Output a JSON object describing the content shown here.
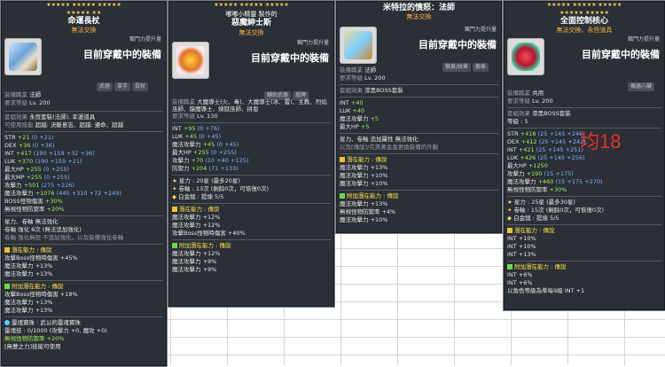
{
  "annotation": "均18",
  "card1": {
    "stars_row1": "★★★★★ ★★★★★ ★★★★★",
    "stars_row2": "★★★★★ ★★",
    "title": "命運長杖",
    "subtitle": "無法交換",
    "upgrade_label": "職門力提升量",
    "wearing": "目前穿戴中的裝備",
    "req_job_label": "裝備職業",
    "req_job": "法師",
    "req_level_label": "要求等級",
    "req_level": "Lv. 200",
    "job_tags": [
      "武器",
      "單手",
      "長杖"
    ],
    "set_label": "套組效果",
    "set_value": "永恆套裝(法師), 幸運道具",
    "trade_label": "可使用技能",
    "trade_value": "超越: 決斷意志、超越: 遵命、超越",
    "lines": [
      {
        "k": "STR",
        "v": "+21",
        "e": "(0 +21)"
      },
      {
        "k": "DEX",
        "v": "+36",
        "e": "(0 +36)"
      },
      {
        "k": "INT",
        "v": "+417",
        "e": "(190 +159 +32 +36)"
      },
      {
        "k": "LUK",
        "v": "+370",
        "e": "(190 +159 +21)"
      },
      {
        "k": "最大HP",
        "v": "+255",
        "e": "(0 +255)"
      },
      {
        "k": "最大MP",
        "v": "+255",
        "e": "(0 +255)"
      },
      {
        "k": "攻擊力",
        "v": "+501",
        "e": "(275 +226)"
      },
      {
        "k": "魔法攻擊力",
        "v": "+1076",
        "e": "(445 +310 +72 +249)"
      },
      {
        "k": "BOSS怪物傷害",
        "v": "+30%",
        "e": ""
      },
      {
        "k": "無視怪物防禦率",
        "v": "+20%",
        "e": ""
      }
    ],
    "star_label": "星力、卷軸 無法強化",
    "scroll_line": "卷軸 強化 8次 (無法追加強化)",
    "extra_note": "卷軸 強化無限 不追加強化。以及裝備強化卷軸",
    "pot_title": "潛在能力 : 傳說",
    "pot_lines": [
      "攻擊Boss怪物時傷害 +45%",
      "魔法攻擊力 +13%",
      "魔法攻擊力 +13%"
    ],
    "add_title": "附加潛在能力 : 傳說",
    "add_lines": [
      "攻擊Boss怪物時傷害 +18%",
      "魔法攻擊力 +13%",
      "魔法攻擊力 +13%"
    ],
    "soul_label": "靈魂寶珠 : 武公的靈魂寶珠",
    "soul_line": "靈魂技 : 0/1000 (攻擊力 +0, 魔攻 +0)",
    "soul_extra": "無視怪物防禦率 +20%",
    "footer": "[無雙之力]技能可使用"
  },
  "card2": {
    "stars_row1": "★★★★★ ★★★★★ ★★★★★",
    "maker": "嘟嘟小精靈 製作的",
    "title": "惡魔紳士斯",
    "subtitle": "無法交換",
    "upgrade_label": "職門力提升量",
    "wearing": "目前穿戴中的裝備",
    "req_job_label": "裝備職業",
    "req_job": "大魔導士(火、毒)、大魔導士(冰、雷)、主教、烈焰巫師、龍魔導士、煉獄巫師、拼恩",
    "req_level_label": "要求等級",
    "req_level": "Lv. 130",
    "job_tags": [
      "輔助武器",
      "盾牌"
    ],
    "lines": [
      {
        "k": "INT",
        "v": "+95",
        "e": "(0 +76)"
      },
      {
        "k": "LUK",
        "v": "+45",
        "e": "(0 +45)"
      },
      {
        "k": "魔法攻擊力",
        "v": "+45",
        "e": "(0 +45)"
      },
      {
        "k": "最大HP",
        "v": "+255",
        "e": "(0 +255)"
      },
      {
        "k": "攻擊力",
        "v": "+70",
        "e": "(10 +40 +125)"
      },
      {
        "k": "防禦力",
        "v": "+204",
        "e": "(71 +133)"
      }
    ],
    "star_label": "星力 : 20星 (最多20星)",
    "scroll_line": "卷軸 : 13次 (剩餘0次，可恢復0次)",
    "gold": "白金鎚 : 提煉 5/5",
    "pot_title": "潛在能力 : 傳說",
    "pot_lines": [
      "魔法攻擊力 +12%",
      "魔法攻擊力 +12%",
      "攻擊Boss怪物時傷害 +40%"
    ],
    "add_title": "附加潛在能力 : 傳說",
    "add_lines": [
      "魔法攻擊力 +12%",
      "魔法攻擊力 +9%",
      "魔法攻擊力 +9%"
    ]
  },
  "card3": {
    "header": "米特拉的憤怒：法師",
    "subtitle": "無法交換",
    "upgrade_label": "職門力提升量",
    "wearing": "目前穿戴中的裝備",
    "req_job_label": "裝備職業",
    "req_job": "法師",
    "req_level_label": "要求等級",
    "req_level": "Lv. 200",
    "job_tags": [
      "徽章/紋章",
      "徽章"
    ],
    "set_label": "套組效果",
    "set_value": "漆黑BOSS套裝",
    "lines": [
      {
        "k": "INT",
        "v": "+40",
        "e": ""
      },
      {
        "k": "LUK",
        "v": "+40",
        "e": ""
      },
      {
        "k": "魔法攻擊力",
        "v": "+5",
        "e": ""
      },
      {
        "k": "最大HP",
        "v": "+5",
        "e": ""
      }
    ],
    "star_label": "星力、卷軸 追加屬性 無法強化",
    "note": "以及[傳說]/完美黃金蛋更換裝備的外觀",
    "pot_title": "潛在能力 : 傳說",
    "pot_lines": [
      "魔法攻擊力 +13%",
      "魔法攻擊力 +10%",
      "魔法攻擊力 +10%"
    ],
    "add_title": "附加潛在能力 : 傳說",
    "add_lines": [
      "魔法攻擊力 +13%",
      "無視怪物防禦率 +4%",
      "魔法攻擊力 +10%"
    ]
  },
  "card4": {
    "stars_row1": "★★★★★ ★★★★★ ★★★★★",
    "stars_row2": "★★★★★ ★★★★★",
    "title": "全面控制核心",
    "subtitle": "無法交換、永恆道具",
    "upgrade_label": "職門力提升量",
    "wearing": "目前穿戴中的裝備",
    "req_job_label": "裝備職業",
    "req_job": "共用",
    "req_level_label": "要求等級",
    "req_level": "Lv. 200",
    "job_tags": [
      "機器心臟"
    ],
    "set_label": "套組效果",
    "set_value": "漆黑BOSS套裝",
    "level_line": "等級 : 5",
    "lines": [
      {
        "k": "STR",
        "v": "+416",
        "e": "(25 +145 +246)"
      },
      {
        "k": "DEX",
        "v": "+412",
        "e": "(25 +145 +242)"
      },
      {
        "k": "INT",
        "v": "+421",
        "e": "(25 +145 +251)"
      },
      {
        "k": "LUK",
        "v": "+426",
        "e": "(25 +145 +256)"
      },
      {
        "k": "最大HP",
        "v": "+1250",
        "e": ""
      },
      {
        "k": "攻擊力",
        "v": "+190",
        "e": "(15 +175)"
      },
      {
        "k": "魔法攻擊力",
        "v": "+460",
        "e": "(15 +175 +270)"
      },
      {
        "k": "無視怪物防禦率",
        "v": "+30%",
        "e": ""
      }
    ],
    "star_label": "星力 : 25星 (最多30星)",
    "scroll_line": "卷軸 : 15次 (剩餘0次，可恢復0次)",
    "gold": "白金鎚 : 提煉 5/5",
    "pot_title": "潛在能力 : 傳說",
    "pot_lines": [
      "INT +10%",
      "INT +10%",
      "INT +13%"
    ],
    "add_title": "附加潛在能力 : 傳說",
    "add_lines": [
      "INT +6%",
      "INT +6%",
      "以角色等級為準每9級 INT +1"
    ]
  }
}
